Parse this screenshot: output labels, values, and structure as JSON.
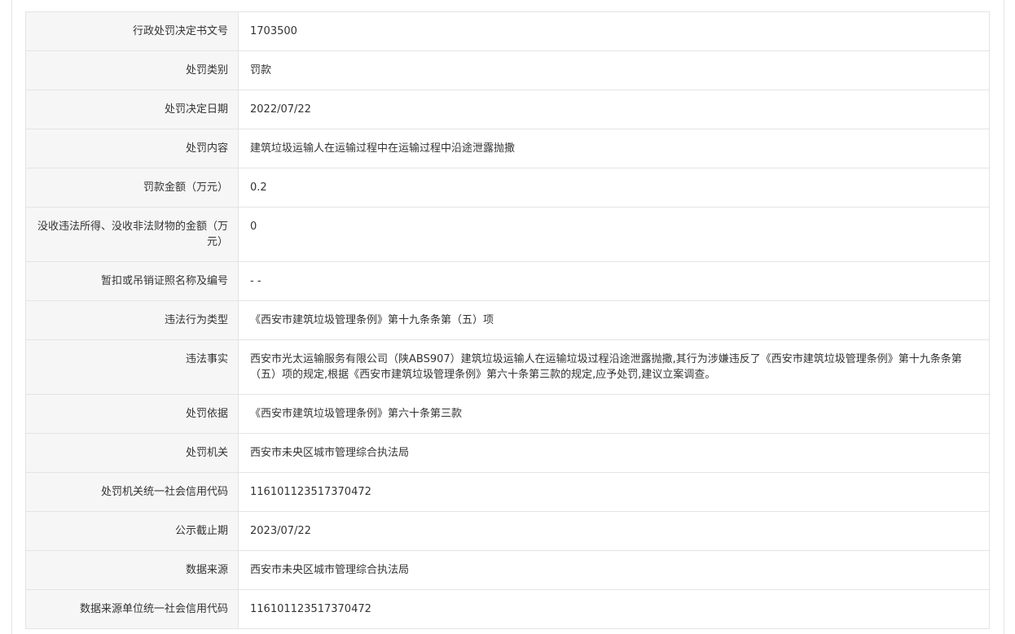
{
  "rows": [
    {
      "label": "行政处罚决定书文号",
      "value": "1703500"
    },
    {
      "label": "处罚类别",
      "value": "罚款"
    },
    {
      "label": "处罚决定日期",
      "value": "2022/07/22"
    },
    {
      "label": "处罚内容",
      "value": "建筑垃圾运输人在运输过程中在运输过程中沿途泄露抛撒"
    },
    {
      "label": "罚款金额（万元）",
      "value": "0.2"
    },
    {
      "label": "没收违法所得、没收非法财物的金额（万元）",
      "value": "0"
    },
    {
      "label": "暂扣或吊销证照名称及编号",
      "value": "- -"
    },
    {
      "label": "违法行为类型",
      "value": "《西安市建筑垃圾管理条例》第十九条条第（五）项"
    },
    {
      "label": "违法事实",
      "value": "西安市光太运输服务有限公司（陕ABS907）建筑垃圾运输人在运输垃圾过程沿途泄露抛撒,其行为涉嫌违反了《西安市建筑垃圾管理条例》第十九条条第（五）项的规定,根据《西安市建筑垃圾管理条例》第六十条第三款的规定,应予处罚,建议立案调查。"
    },
    {
      "label": "处罚依据",
      "value": "《西安市建筑垃圾管理条例》第六十条第三款"
    },
    {
      "label": "处罚机关",
      "value": "西安市未央区城市管理综合执法局"
    },
    {
      "label": "处罚机关统一社会信用代码",
      "value": "116101123517370472"
    },
    {
      "label": "公示截止期",
      "value": "2023/07/22"
    },
    {
      "label": "数据来源",
      "value": "西安市未央区城市管理综合执法局"
    },
    {
      "label": "数据来源单位统一社会信用代码",
      "value": "116101123517370472"
    }
  ]
}
